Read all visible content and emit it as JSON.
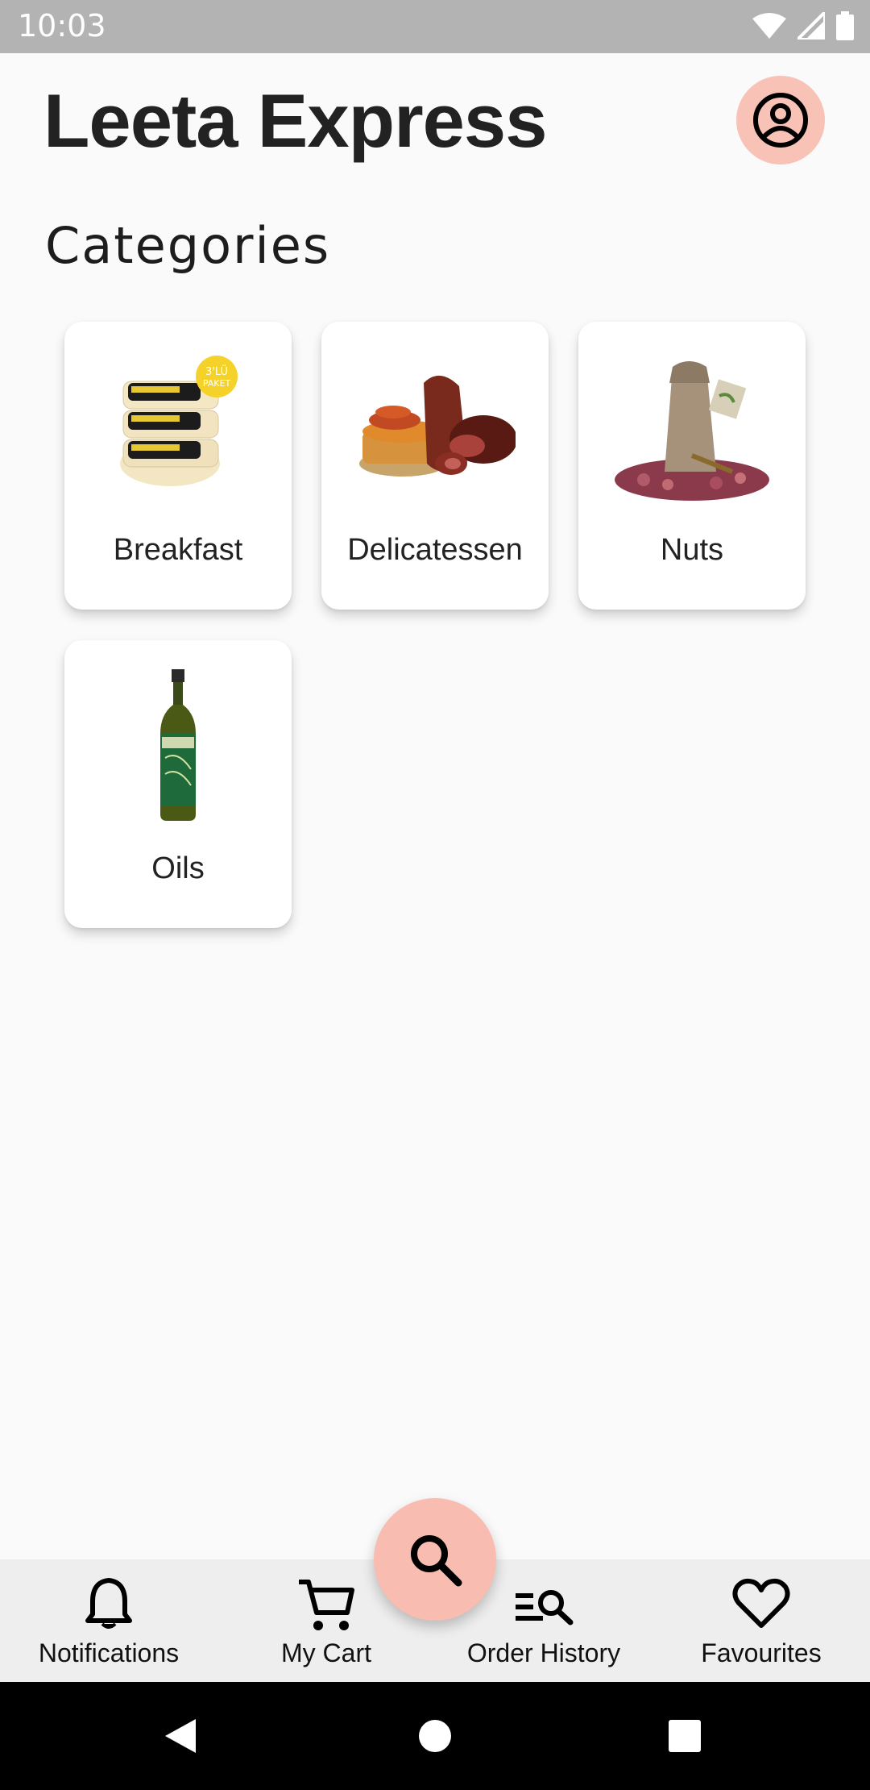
{
  "status_bar": {
    "time": "10:03"
  },
  "header": {
    "title": "Leeta Express"
  },
  "section": {
    "title": "Categories"
  },
  "categories": [
    {
      "label": "Breakfast",
      "icon": "cheese-pack-image"
    },
    {
      "label": "Delicatessen",
      "icon": "cured-meats-image"
    },
    {
      "label": "Nuts",
      "icon": "pistachio-sack-image"
    },
    {
      "label": "Oils",
      "icon": "olive-oil-bottle-image"
    }
  ],
  "bottom_nav": {
    "items": [
      {
        "label": "Notifications",
        "icon": "bell-icon"
      },
      {
        "label": "My Cart",
        "icon": "cart-icon"
      },
      {
        "label": "Order History",
        "icon": "order-history-icon"
      },
      {
        "label": "Favourites",
        "icon": "heart-icon"
      }
    ],
    "fab_icon": "search-icon"
  },
  "colors": {
    "accent": "#f8bcb0",
    "status_bar": "#b3b3b3",
    "background": "#fafafa",
    "nav_background": "#eeeeee"
  }
}
